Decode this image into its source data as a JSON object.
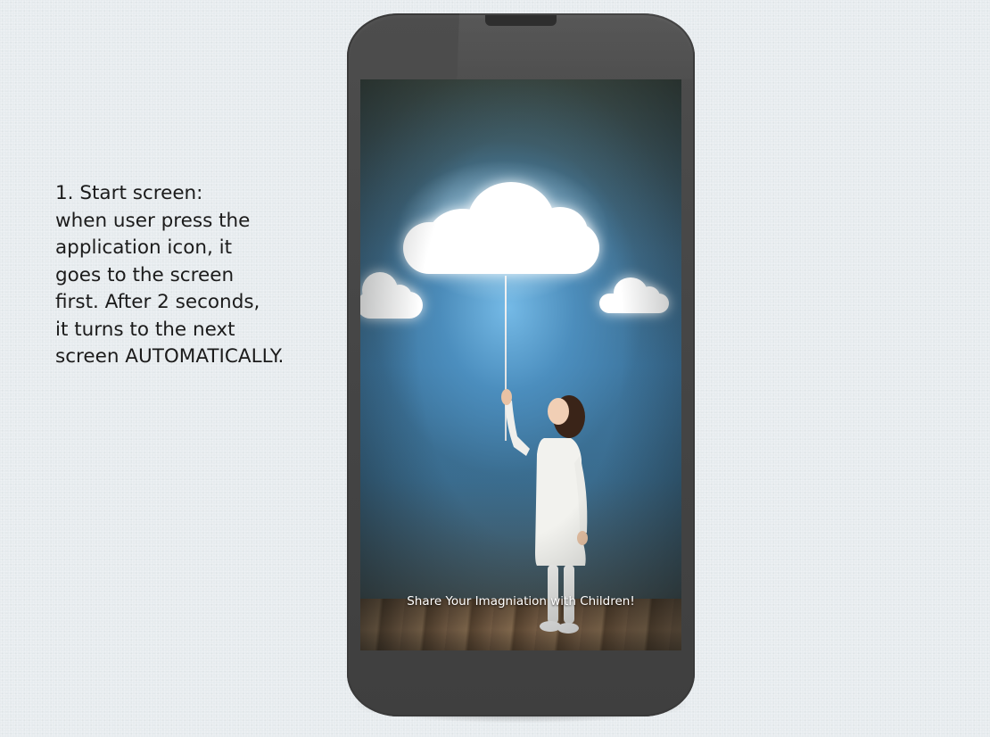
{
  "description": {
    "lines": [
      "1. Start screen:",
      "when user press the",
      "application icon, it",
      "goes to the screen",
      "first. After 2 seconds,",
      "it turns to the next",
      "screen AUTOMATICALLY."
    ]
  },
  "splash": {
    "caption": "Share Your Imagniation with Children!"
  },
  "colors": {
    "phone_body": "#454545",
    "background": "#e6ebee",
    "caption_text": "#ffffff"
  }
}
